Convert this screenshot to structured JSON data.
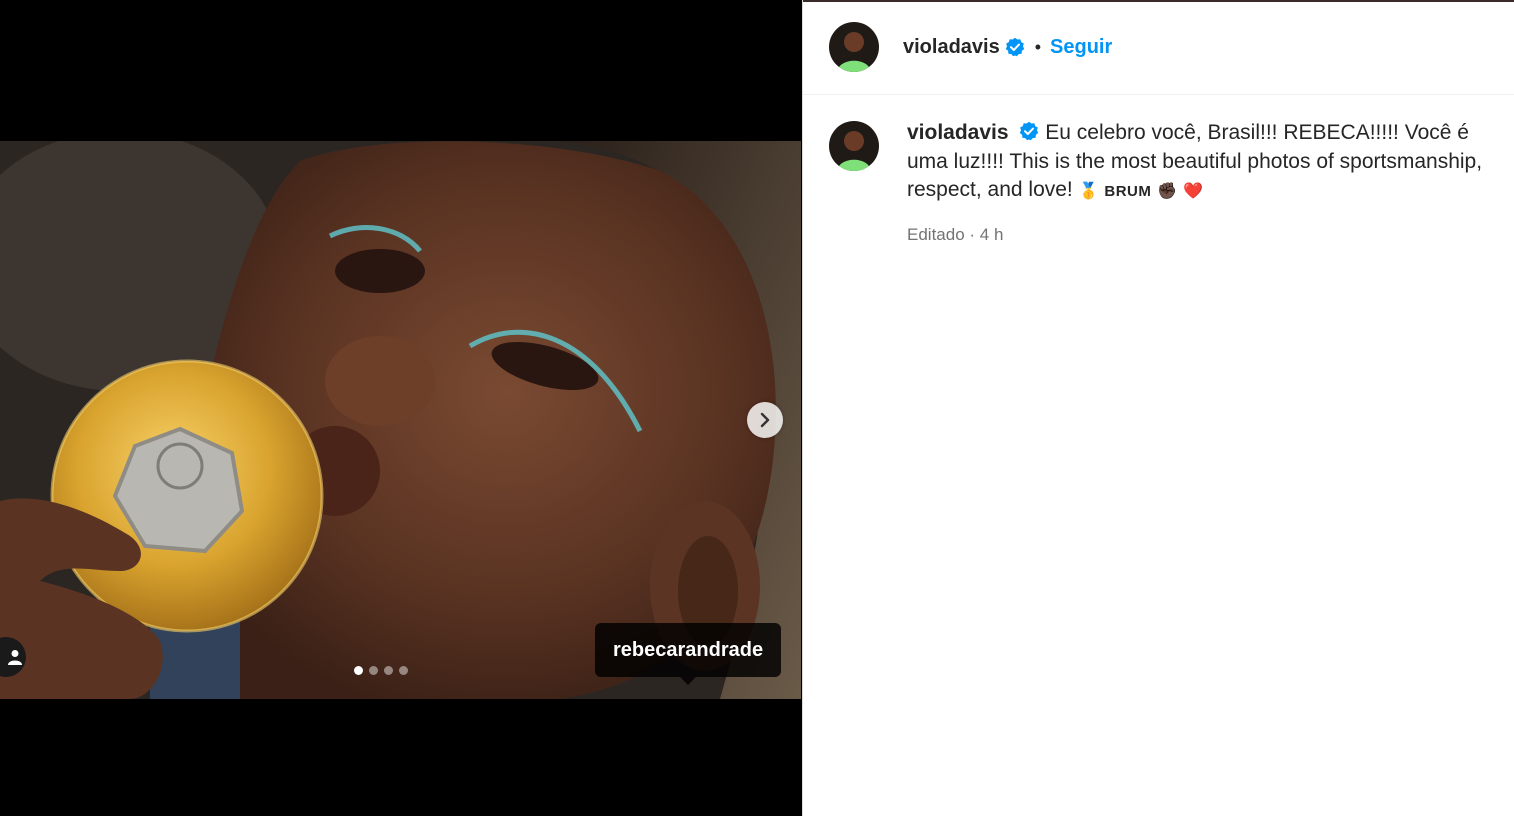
{
  "post": {
    "author": "violadavis",
    "follow_label": "Seguir",
    "separator": "•",
    "caption": "Eu celebro você, Brasil!!! REBECA!!!!! Você é uma luz!!!! This is the most beautiful photos of sportsmanship, respect, and love! ",
    "caption_emoji_1": "🥇",
    "caption_word": "BRUM",
    "caption_emoji_2": "✊🏿",
    "caption_emoji_3": "❤️",
    "meta": "Editado · 4 h"
  },
  "media": {
    "tagged_user": "rebecarandrade",
    "carousel_count": 4,
    "carousel_active_index": 0
  },
  "colors": {
    "accent": "#0095f6",
    "verified": "#0095f6",
    "text": "#262626",
    "muted": "#737373",
    "media_bg": "#000000"
  },
  "icons": {
    "next": "chevron-right-icon",
    "tag_people": "person-icon",
    "verified": "verified-badge-icon"
  }
}
